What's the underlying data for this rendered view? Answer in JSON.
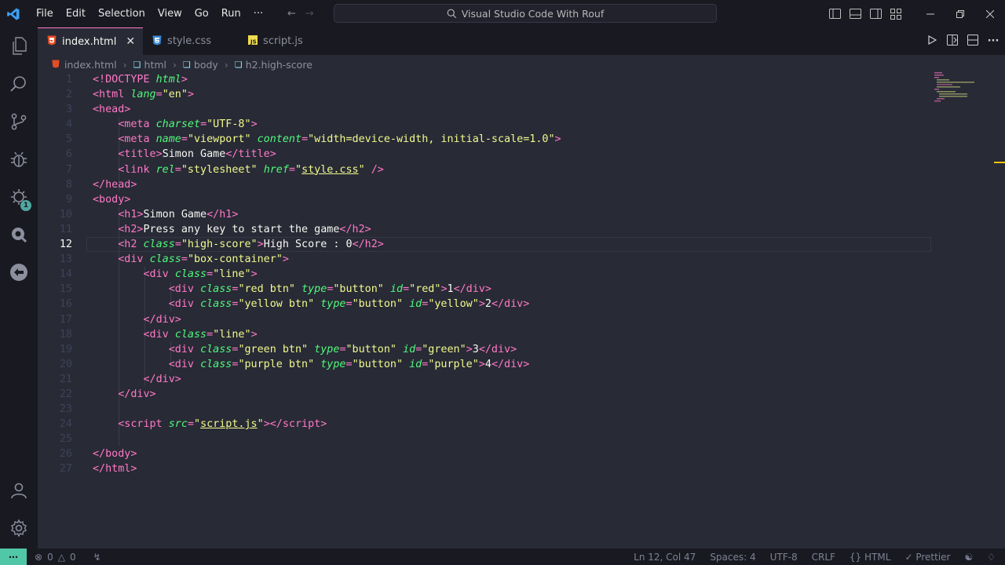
{
  "window": {
    "search_text": "Visual Studio Code With Rouf",
    "menu": [
      "File",
      "Edit",
      "Selection",
      "View",
      "Go",
      "Run",
      "···"
    ]
  },
  "tabs": [
    {
      "label": "index.html",
      "icon": "html5-icon",
      "active": true
    },
    {
      "label": "style.css",
      "icon": "css3-icon",
      "active": false
    },
    {
      "label": "script.js",
      "icon": "js-icon",
      "active": false
    }
  ],
  "breadcrumb": [
    "index.html",
    "html",
    "body",
    "h2.high-score"
  ],
  "activity_badge": "1",
  "code": {
    "line_numbers": [
      "1",
      "2",
      "3",
      "4",
      "5",
      "6",
      "7",
      "8",
      "9",
      "10",
      "11",
      "12",
      "13",
      "14",
      "15",
      "16",
      "17",
      "18",
      "19",
      "20",
      "21",
      "22",
      "23",
      "24",
      "25",
      "26",
      "27"
    ],
    "current_line": "12"
  },
  "status": {
    "errors": "0",
    "warnings": "0",
    "position": "Ln 12, Col 47",
    "spaces": "Spaces: 4",
    "encoding": "UTF-8",
    "eol": "CRLF",
    "language": "HTML",
    "formatter": "Prettier"
  },
  "colors": {
    "background": "#282a36",
    "chrome": "#191a21",
    "tag": "#ff79c6",
    "attribute": "#50fa7b",
    "string": "#f1fa8c",
    "accent": "#50c8a8"
  }
}
